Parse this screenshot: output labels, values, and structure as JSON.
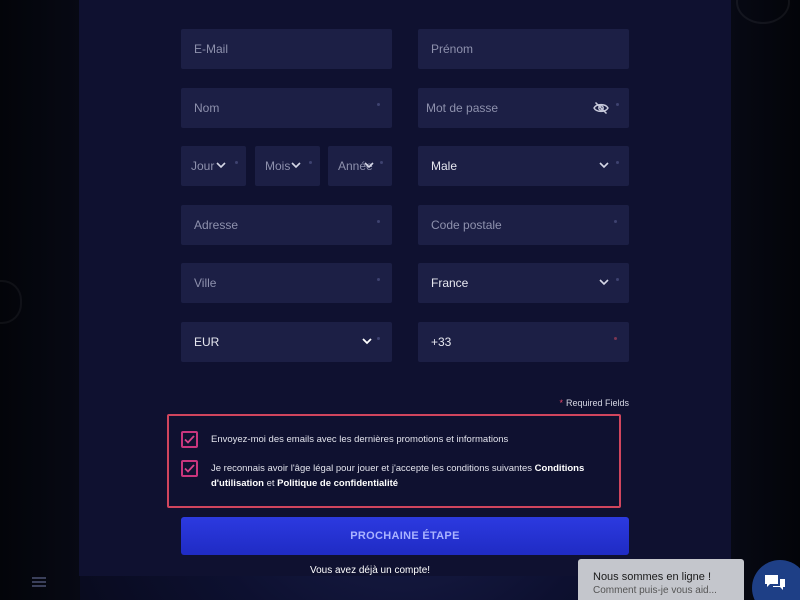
{
  "form": {
    "email_placeholder": "E-Mail",
    "prenom_placeholder": "Prénom",
    "nom_placeholder": "Nom",
    "password_placeholder": "Mot de passe",
    "day_placeholder": "Jour",
    "month_placeholder": "Mois",
    "year_placeholder": "Année",
    "gender_value": "Male",
    "address_placeholder": "Adresse",
    "postal_placeholder": "Code postale",
    "city_placeholder": "Ville",
    "country_value": "France",
    "currency_value": "EUR",
    "phone_prefix": "+33"
  },
  "required_note": {
    "star": "*",
    "label": "Required Fields"
  },
  "consent": {
    "newsletter_text": "Envoyez-moi des emails avec les dernières promotions et informations",
    "newsletter_checked": true,
    "age_text": "Je reconnais avoir l'âge légal pour jouer et j'accepte les conditions suivantes",
    "terms_link": "Conditions d'utilisation",
    "and_text": "et",
    "privacy_link": "Politique de confidentialité",
    "age_checked": true
  },
  "next_button_label": "PROCHAINE ÉTAPE",
  "login_link": "Vous avez déjà un compte!",
  "chat": {
    "status": "Nous sommes en ligne !",
    "prompt": "Comment puis-je vous aid..."
  },
  "colors": {
    "panel": "#0f1130",
    "field": "#1c1f45",
    "accent_border": "#d0455d",
    "checkbox": "#c9357d",
    "button": "#2c3ae0"
  }
}
